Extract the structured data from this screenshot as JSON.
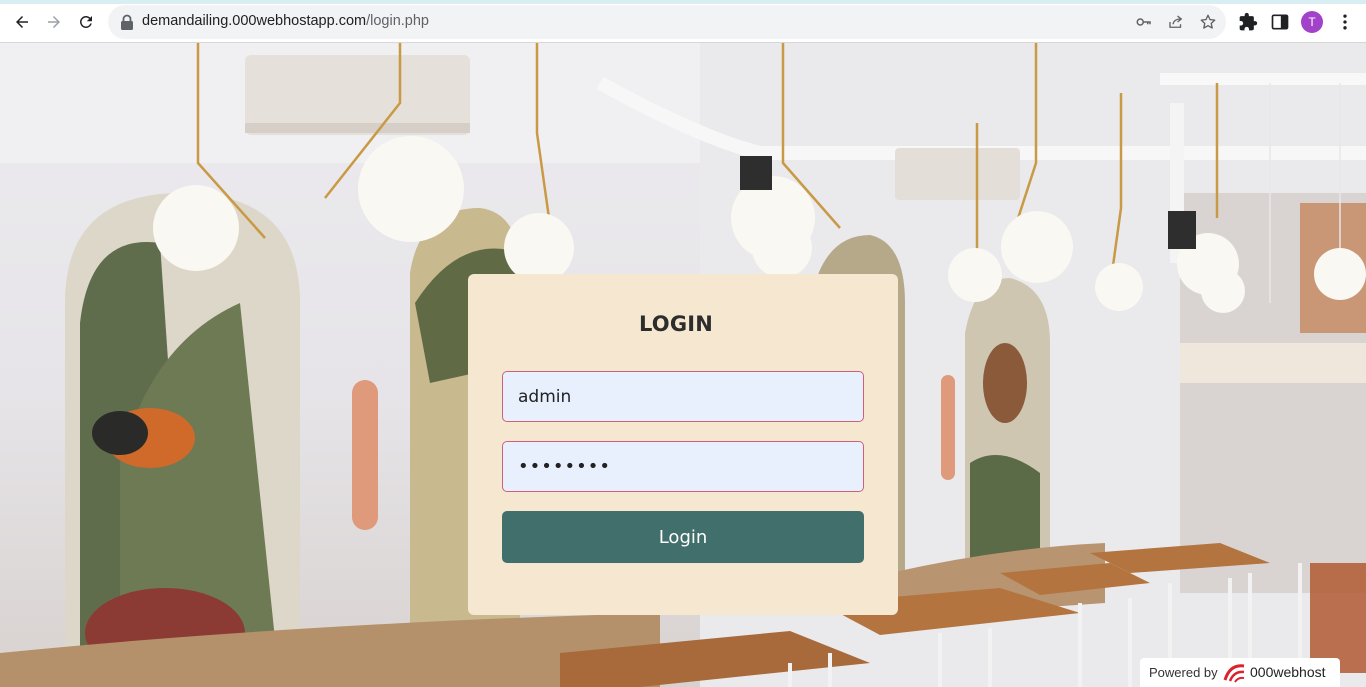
{
  "browser": {
    "url_host": "demandailing.000webhostapp.com",
    "url_path": "/login.php",
    "profile_initial": "T",
    "profile_color": "#a142c9",
    "icons": [
      "back-arrow-icon",
      "forward-arrow-icon",
      "reload-icon",
      "lock-icon",
      "key-icon",
      "share-icon",
      "star-icon",
      "puzzle-icon",
      "side-panel-icon",
      "more-vert-icon"
    ]
  },
  "login": {
    "title": "LOGIN",
    "username_value": "admin",
    "password_value": "••••••••",
    "button_label": "Login"
  },
  "footer": {
    "powered_label": "Powered by",
    "brand": "000webhost"
  },
  "colors": {
    "card_bg": "#f6e8d0",
    "button_bg": "#416f6b",
    "input_bg": "#e8f0fe",
    "input_border": "#d0607a"
  }
}
